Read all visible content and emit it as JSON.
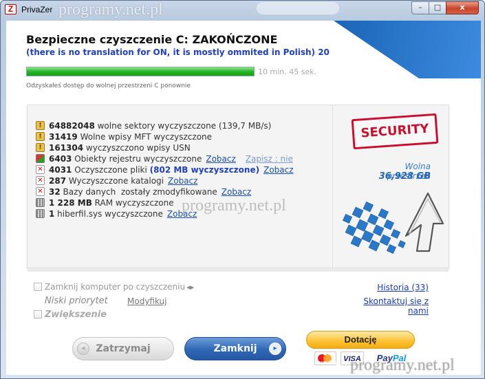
{
  "window": {
    "title": "PrivaZer",
    "app_icon_glyph": "Z",
    "controls": {
      "minimize": "–",
      "maximize": "□",
      "close": "x"
    }
  },
  "watermark": {
    "text": "programy.net.pl"
  },
  "header": {
    "title": "Bezpieczne czyszczenie C: ZAKOŃCZONE",
    "subtitle": "(there is no translation for ON, it is mostly ommited in Polish) 20",
    "accent_color": "#2472c7"
  },
  "progress": {
    "value": 1.0,
    "time": "10 min. 45 sek.",
    "note": "Odzyskałeś dostęp do wolnej przestrzeni C ponownie",
    "color": "#26b526"
  },
  "results": [
    {
      "icon": "lock-icon",
      "bold": "64882048",
      "text": " wolne sektory wyczyszczone (139,7 MB/s)"
    },
    {
      "icon": "lock-icon",
      "bold": "31419",
      "text": " Wolne wpisy MFT wyczyszczone"
    },
    {
      "icon": "lock-icon",
      "bold": "161304",
      "text": " wyczyszczono wpisy USN"
    },
    {
      "icon": "puzzle-icon",
      "bold": "6403",
      "text": " Obiekty rejestru wyczyszczone",
      "link": "Zobacz",
      "link2": "Zapisz : nie"
    },
    {
      "icon": "x-icon",
      "bold": "4031",
      "text": " Oczyszczone pliki ",
      "highlight": "(802 MB wyczyszczone)",
      "link": "Zobacz"
    },
    {
      "icon": "x-icon",
      "bold": "287",
      "text": " Wyczyszczone katalogi",
      "link": "Zobacz"
    },
    {
      "icon": "x-icon",
      "bold": "32",
      "text": " Bazy danych  zostały zmodyfikowane",
      "link": "Zobacz"
    },
    {
      "icon": "ram-icon",
      "bold": "1 228 MB",
      "text": " RAM wyczyszczone"
    },
    {
      "icon": "ram-icon",
      "bold": "1",
      "text": " hiberfil.sys wyczyszczone",
      "link": "Zobacz"
    }
  ],
  "security": {
    "stamp": "SECURITY",
    "free_space_label": "Wolna przestrzeń",
    "free_space_value": "36,928 GB",
    "stamp_color": "#c8102e"
  },
  "options": {
    "shutdown": "Zamknij komputer po czyszczeniu",
    "shutdown_arrows": "◂▸",
    "priority": "Niski priorytet",
    "priority_link": "Modyfikuj",
    "boost": "Zwiększenie"
  },
  "links": {
    "history": "Historia (33)",
    "contact": "Skontaktuj się z nami"
  },
  "buttons": {
    "pause": "Zatrzymaj",
    "pause_icon": "◂",
    "close": "Zamknij",
    "close_icon": "▸",
    "donate": "Dotację"
  },
  "payment": {
    "mastercard": "MasterCard",
    "visa": "VISA",
    "paypal_a": "Pay",
    "paypal_b": "Pal"
  }
}
